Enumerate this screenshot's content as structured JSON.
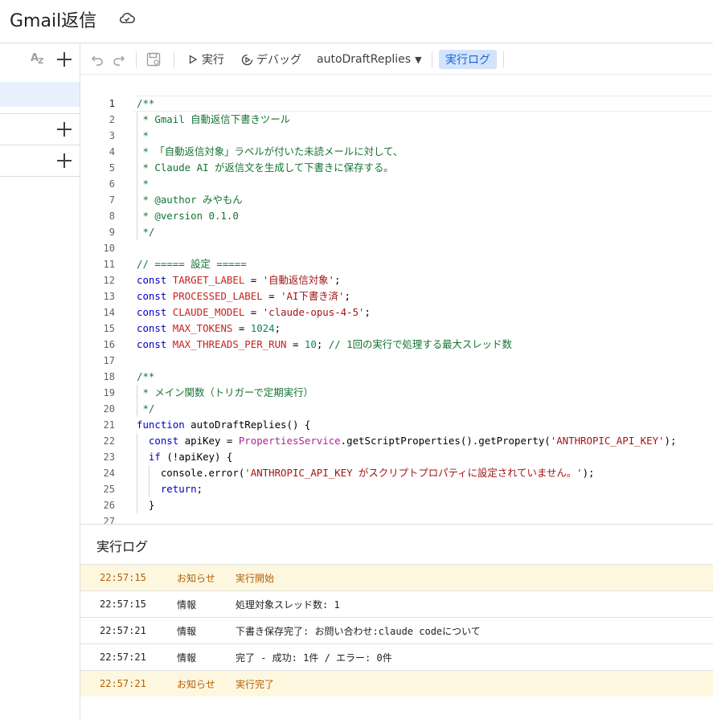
{
  "header": {
    "title": "Gmail返信",
    "cloud_icon": "cloud-done-icon"
  },
  "sidebar": {
    "sort_icon": "az-sort-icon",
    "add_icon": "plus-icon"
  },
  "toolbar": {
    "undo_icon": "undo-icon",
    "redo_icon": "redo-icon",
    "save_icon": "save-icon",
    "run_label": "実行",
    "debug_label": "デバッグ",
    "function_name": "autoDraftReplies",
    "log_label": "実行ログ"
  },
  "code_lines": [
    {
      "n": "1",
      "t": "/**"
    },
    {
      "n": "2",
      "t": " * Gmail 自動返信下書きツール"
    },
    {
      "n": "3",
      "t": " *"
    },
    {
      "n": "4",
      "t": " * 「自動返信対象」ラベルが付いた未読メールに対して、"
    },
    {
      "n": "5",
      "t": " * Claude AI が返信文を生成して下書きに保存する。"
    },
    {
      "n": "6",
      "t": " *"
    },
    {
      "n": "7",
      "t": " * @author みやもん"
    },
    {
      "n": "8",
      "t": " * @version 0.1.0"
    },
    {
      "n": "9",
      "t": " */"
    },
    {
      "n": "10",
      "t": ""
    },
    {
      "n": "11",
      "t": "// ===== 設定 ====="
    },
    {
      "n": "12",
      "kw": "const ",
      "name": "TARGET_LABEL",
      "op": " = ",
      "val": "'自動返信対象'",
      "end": ";"
    },
    {
      "n": "13",
      "kw": "const ",
      "name": "PROCESSED_LABEL",
      "op": " = ",
      "val": "'AI下書き済'",
      "end": ";"
    },
    {
      "n": "14",
      "kw": "const ",
      "name": "CLAUDE_MODEL",
      "op": " = ",
      "val": "'claude-opus-4-5'",
      "end": ";"
    },
    {
      "n": "15",
      "kw": "const ",
      "name": "MAX_TOKENS",
      "op": " = ",
      "num": "1024",
      "end": ";"
    },
    {
      "n": "16",
      "kw": "const ",
      "name": "MAX_THREADS_PER_RUN",
      "op": " = ",
      "num": "10",
      "end": "; ",
      "cm": "// 1回の実行で処理する最大スレッド数"
    },
    {
      "n": "17",
      "t": ""
    },
    {
      "n": "18",
      "t": "/**"
    },
    {
      "n": "19",
      "t": " * メイン関数（トリガーで定期実行）"
    },
    {
      "n": "20",
      "t": " */"
    },
    {
      "n": "21",
      "kw": "function ",
      "plain": "autoDraftReplies() {"
    },
    {
      "n": "22",
      "indent": "  ",
      "kw": "const ",
      "plain": "apiKey = ",
      "cls": "PropertiesService",
      "rest": ".getScriptProperties().getProperty(",
      "val": "'ANTHROPIC_API_KEY'",
      "end": ");"
    },
    {
      "n": "23",
      "indent": "  ",
      "kw": "if ",
      "plain": "(!apiKey) {"
    },
    {
      "n": "24",
      "indent": "    ",
      "plain": "console.error(",
      "val": "'ANTHROPIC_API_KEY がスクリプトプロパティに設定されていません。'",
      "end": ");"
    },
    {
      "n": "25",
      "indent": "    ",
      "kw": "return",
      "end": ";"
    },
    {
      "n": "26",
      "indent": "  ",
      "plain": "}"
    },
    {
      "n": "27",
      "t": ""
    }
  ],
  "log": {
    "title": "実行ログ",
    "rows": [
      {
        "time": "22:57:15",
        "level": "お知らせ",
        "msg": "実行開始",
        "kind": "notice"
      },
      {
        "time": "22:57:15",
        "level": "情報",
        "msg": "処理対象スレッド数: 1",
        "kind": "info"
      },
      {
        "time": "22:57:21",
        "level": "情報",
        "msg": "下書き保存完了: お問い合わせ:claude codeについて",
        "kind": "info"
      },
      {
        "time": "22:57:21",
        "level": "情報",
        "msg": "完了 - 成功: 1件 / エラー: 0件",
        "kind": "info"
      },
      {
        "time": "22:57:21",
        "level": "お知らせ",
        "msg": "実行完了",
        "kind": "notice"
      }
    ]
  }
}
